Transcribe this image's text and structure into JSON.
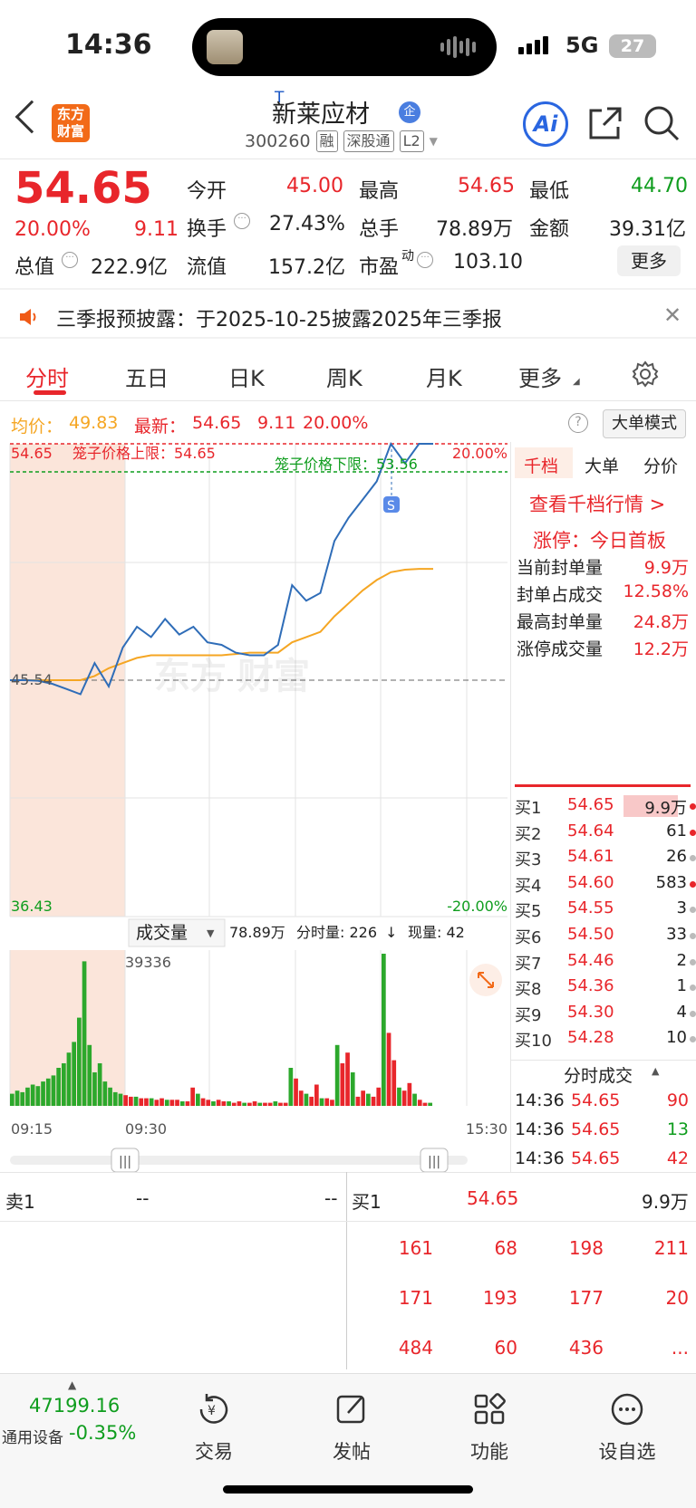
{
  "status": {
    "time": "14:36",
    "network": "5G",
    "battery": "27"
  },
  "header": {
    "logo_line1": "东方",
    "logo_line2": "财富",
    "t_mark": "T",
    "name": "新莱应材",
    "badge": "企",
    "code": "300260",
    "tags": [
      "融",
      "深股通",
      "L2"
    ],
    "ai_label": "Ai"
  },
  "quote": {
    "price": "54.65",
    "change_pct": "20.00%",
    "change": "9.11",
    "open_label": "今开",
    "open": "45.00",
    "high_label": "最高",
    "high": "54.65",
    "low_label": "最低",
    "low": "44.70",
    "turnover_label": "换手",
    "turnover": "27.43%",
    "volume_label": "总手",
    "volume": "78.89万",
    "amount_label": "金额",
    "amount": "39.31亿",
    "mktcap_label": "总值",
    "mktcap": "222.9亿",
    "float_label": "流值",
    "float": "157.2亿",
    "pe_label": "市盈",
    "pe_sup": "动",
    "pe": "103.10",
    "more_button": "更多"
  },
  "notice": {
    "text": "三季报预披露：于2025-10-25披露2025年三季报"
  },
  "tabs": [
    "分时",
    "五日",
    "日K",
    "周K",
    "月K",
    "更多"
  ],
  "info_line": {
    "avg_label": "均价：",
    "avg": "49.83",
    "latest_label": "最新：",
    "latest": "54.65",
    "latest_change": "9.11",
    "latest_pct": "20.00%",
    "big_order_button": "大单模式"
  },
  "chart_data": {
    "type": "line",
    "title": "",
    "price_axis": {
      "top": "54.65",
      "mid": "45.54",
      "bottom": "36.43"
    },
    "pct_axis": {
      "top": "20.00%",
      "bottom": "-20.00%"
    },
    "annotations": {
      "upper_limit": "笼子价格上限：54.65",
      "lower_limit": "笼子价格下限：53.56",
      "marker": "S"
    },
    "ylim": [
      36.43,
      54.65
    ],
    "x_labels": [
      "09:15",
      "09:30",
      "15:30"
    ],
    "series": [
      {
        "values": [
          45.54,
          45.54,
          45.52,
          45.4,
          45.2,
          45.0,
          46.2,
          45.3,
          46.8,
          47.6,
          47.2,
          47.9,
          47.3,
          47.6,
          47.0,
          46.9,
          46.6,
          46.5,
          46.5,
          46.9,
          49.2,
          48.6,
          48.9,
          50.9,
          51.8,
          52.5,
          53.2,
          54.65,
          53.9,
          54.65,
          54.65
        ]
      },
      {
        "values": [
          45.54,
          45.54,
          45.54,
          45.54,
          45.54,
          45.54,
          45.7,
          46.0,
          46.2,
          46.4,
          46.5,
          46.5,
          46.5,
          46.5,
          46.5,
          46.5,
          46.55,
          46.6,
          46.6,
          46.6,
          47.0,
          47.2,
          47.4,
          48.0,
          48.5,
          49.0,
          49.4,
          49.7,
          49.8,
          49.83,
          49.83
        ]
      }
    ],
    "volume_label": "成交量",
    "volume_total": "78.89万",
    "volume_interval": "分时量: 226",
    "volume_now": "现量: 42",
    "volume_max_label": "39336",
    "volume_bars": [
      8,
      10,
      9,
      12,
      14,
      13,
      16,
      18,
      20,
      25,
      28,
      35,
      42,
      58,
      95,
      40,
      22,
      28,
      16,
      12,
      9,
      8,
      7,
      6,
      6,
      5,
      5,
      5,
      4,
      5,
      4,
      4,
      4,
      3,
      3,
      12,
      8,
      5,
      4,
      3,
      4,
      3,
      3,
      2,
      3,
      2,
      2,
      3,
      2,
      2,
      2,
      3,
      2,
      2,
      25,
      18,
      10,
      8,
      6,
      14,
      5,
      5,
      4,
      40,
      28,
      35,
      22,
      6,
      10,
      8,
      6,
      12,
      100,
      48,
      30,
      12,
      10,
      15,
      8,
      4,
      2,
      2
    ]
  },
  "order_panel": {
    "tabs": [
      "千档",
      "大单",
      "分价"
    ],
    "view_link": "查看千档行情 >",
    "limit_status": "涨停：今日首板",
    "stats": [
      {
        "label": "当前封单量",
        "value": "9.9万"
      },
      {
        "label": "封单占成交",
        "value": "12.58%"
      },
      {
        "label": "最高封单量",
        "value": "24.8万"
      },
      {
        "label": "涨停成交量",
        "value": "12.2万"
      }
    ],
    "bids": [
      {
        "label": "买1",
        "price": "54.65",
        "vol": "9.9万"
      },
      {
        "label": "买2",
        "price": "54.64",
        "vol": "61"
      },
      {
        "label": "买3",
        "price": "54.61",
        "vol": "26"
      },
      {
        "label": "买4",
        "price": "54.60",
        "vol": "583"
      },
      {
        "label": "买5",
        "price": "54.55",
        "vol": "3"
      },
      {
        "label": "买6",
        "price": "54.50",
        "vol": "33"
      },
      {
        "label": "买7",
        "price": "54.46",
        "vol": "2"
      },
      {
        "label": "买8",
        "price": "54.36",
        "vol": "1"
      },
      {
        "label": "买9",
        "price": "54.30",
        "vol": "4"
      },
      {
        "label": "买10",
        "price": "54.28",
        "vol": "10"
      }
    ],
    "trades_title": "分时成交",
    "trades": [
      {
        "time": "14:36",
        "price": "54.65",
        "vol": "90"
      },
      {
        "time": "14:36",
        "price": "54.65",
        "vol": "13"
      },
      {
        "time": "14:36",
        "price": "54.65",
        "vol": "42"
      }
    ]
  },
  "order_table": {
    "sell_label": "卖1",
    "sell_price": "--",
    "sell_vol": "--",
    "buy_label": "买1",
    "buy_price": "54.65",
    "buy_vol": "9.9万",
    "queue": [
      [
        "161",
        "68",
        "198",
        "211"
      ],
      [
        "171",
        "193",
        "177",
        "20"
      ],
      [
        "484",
        "60",
        "436",
        "..."
      ]
    ]
  },
  "bottom": {
    "index_value": "47199.16",
    "index_name": "通用设备",
    "index_change": "-0.35%",
    "nav": [
      "交易",
      "发帖",
      "功能",
      "设自选"
    ]
  },
  "colors": {
    "up": "#e8262b",
    "down": "#0f9d1e",
    "price_line": "#2f6db8",
    "avg_line": "#f5a623",
    "accent": "#f26a18"
  }
}
